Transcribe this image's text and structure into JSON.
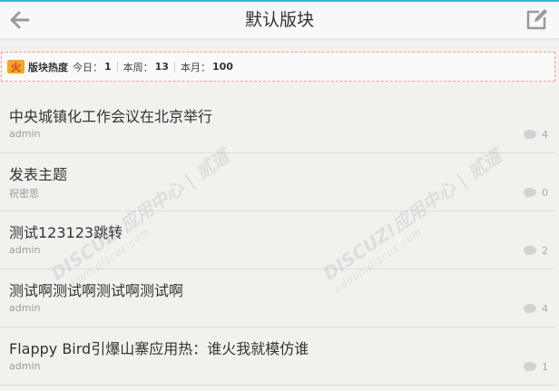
{
  "header": {
    "title": "默认版块"
  },
  "stats": {
    "fire_label": "火",
    "title": "版块热度",
    "today_label": "今日：",
    "today_value": "1",
    "week_label": "本周：",
    "week_value": "13",
    "month_label": "本月：",
    "month_value": "100"
  },
  "threads": [
    {
      "title": "中央城镇化工作会议在北京举行",
      "author": "admin",
      "replies": "4"
    },
    {
      "title": "发表主题",
      "author": "祝密思",
      "replies": "0"
    },
    {
      "title": "测试123123跳转",
      "author": "admin",
      "replies": "2"
    },
    {
      "title": "测试啊测试啊测试啊测试啊",
      "author": "admin",
      "replies": "4"
    },
    {
      "title": "Flappy Bird引爆山寨应用热：谁火我就模仿谁",
      "author": "admin",
      "replies": "1"
    }
  ],
  "watermark": {
    "brand": "DISCUZ!应用中心 | 贰道",
    "domain": "addon.discuz.com"
  },
  "colors": {
    "accent": "#36b4e0",
    "stats_border": "#f09a9a",
    "fire_icon": "#f5a623"
  },
  "icons": {
    "back": "back-arrow-icon",
    "post": "edit-icon",
    "reply": "comment-icon",
    "fire": "fire-icon"
  }
}
